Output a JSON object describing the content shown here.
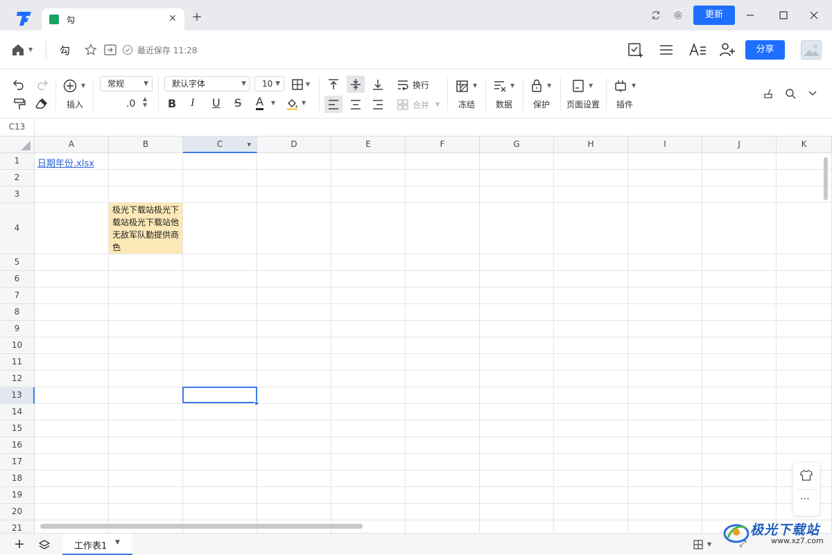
{
  "tabbar": {
    "tab_title": "勾",
    "update_label": "更新"
  },
  "docbar": {
    "doc_title": "勾",
    "save_status": "最近保存 11:28",
    "share_label": "分享"
  },
  "toolbar": {
    "insert_label": "插入",
    "number_format": "常规",
    "decimal_label": ".0",
    "font_name": "默认字体",
    "font_size": "10",
    "wrap_label": "换行",
    "merge_label": "合并",
    "freeze_label": "冻结",
    "data_label": "数据",
    "protect_label": "保护",
    "page_setup_label": "页面设置",
    "plugin_label": "插件"
  },
  "formula_bar": {
    "cell_ref": "C13"
  },
  "grid": {
    "columns": [
      "A",
      "B",
      "C",
      "D",
      "E",
      "F",
      "G",
      "H",
      "I",
      "J",
      "K"
    ],
    "rows": [
      "1",
      "2",
      "3",
      "4",
      "5",
      "6",
      "7",
      "8",
      "9",
      "10",
      "11",
      "12",
      "13",
      "14",
      "15",
      "16",
      "17",
      "18",
      "19",
      "20",
      "21"
    ],
    "selected_column": "C",
    "selected_row": "13",
    "cell_a1": "日期年份.xlsx",
    "cell_b4": "极光下载站极光下载站极光下载站他无敌军队勤提供商色"
  },
  "sheets": {
    "active_name": "工作表1"
  },
  "watermark": {
    "brand": "极光下载站",
    "url": "www.xz7.com"
  },
  "colors": {
    "accent": "#1f6fff",
    "selection": "#3b78e7",
    "note_fill": "#fde9b8",
    "link": "#2a62d6"
  }
}
